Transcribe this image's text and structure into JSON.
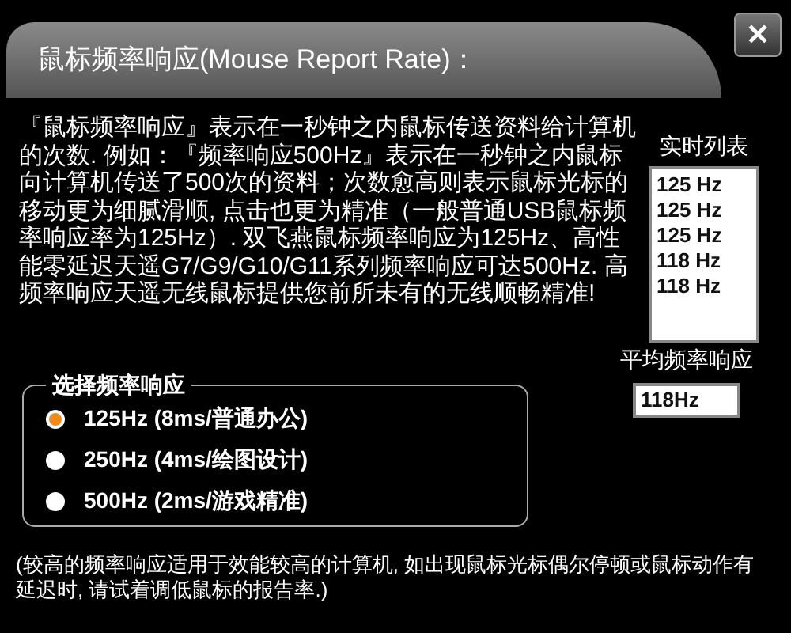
{
  "window": {
    "title": "鼠标频率响应(Mouse Report Rate)：",
    "close": "✕"
  },
  "description": "『鼠标频率响应』表示在一秒钟之内鼠标传送资料给计算机的次数. 例如：『频率响应500Hz』表示在一秒钟之内鼠标向计算机传送了500次的资料；次数愈高则表示鼠标光标的移动更为细腻滑顺, 点击也更为精准（一般普通USB鼠标频率响应率为125Hz）. 双飞燕鼠标频率响应为125Hz、高性能零延迟天遥G7/G9/G10/G11系列频率响应可达500Hz. 高频率响应天遥无线鼠标提供您前所未有的无线顺畅精准!",
  "realtime": {
    "label": "实时列表",
    "items": [
      "125 Hz",
      "125 Hz",
      "125 Hz",
      "118 Hz",
      "118 Hz"
    ]
  },
  "average": {
    "label": "平均频率响应",
    "value": "118Hz"
  },
  "rate_group": {
    "legend": "选择频率响应",
    "options": [
      {
        "label": "125Hz (8ms/普通办公)",
        "selected": true
      },
      {
        "label": "250Hz (4ms/绘图设计)",
        "selected": false
      },
      {
        "label": "500Hz (2ms/游戏精准)",
        "selected": false
      }
    ]
  },
  "note": "(较高的频率响应适用于效能较高的计算机, 如出现鼠标光标偶尔停顿或鼠标动作有延迟时, 请试着调低鼠标的报告率.)"
}
